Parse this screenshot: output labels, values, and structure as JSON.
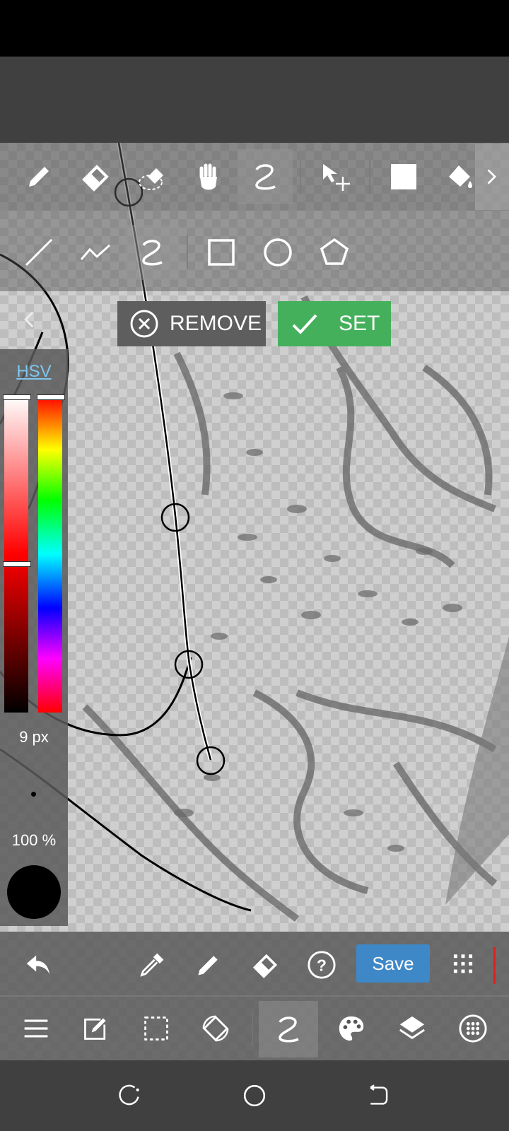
{
  "toolbar_top": {
    "tools": [
      {
        "name": "pencil-icon"
      },
      {
        "name": "eraser-icon"
      },
      {
        "name": "selection-eraser-icon"
      },
      {
        "name": "hand-icon"
      },
      {
        "name": "curve-icon",
        "active": true
      },
      {
        "name": "move-select-icon"
      },
      {
        "name": "fill-rect-icon"
      },
      {
        "name": "fill-bucket-icon"
      },
      {
        "name": "chevron-right-icon"
      }
    ]
  },
  "toolbar_shapes": {
    "tools": [
      {
        "name": "line-icon"
      },
      {
        "name": "polyline-icon"
      },
      {
        "name": "curve-icon",
        "active": true
      },
      {
        "name": "rectangle-icon"
      },
      {
        "name": "circle-icon"
      },
      {
        "name": "pentagon-icon"
      }
    ]
  },
  "actions": {
    "remove_label": "REMOVE",
    "set_label": "SET"
  },
  "color_panel": {
    "mode_label": "HSV",
    "brush_size": "9 px",
    "opacity": "100 %",
    "current_color": "#000000"
  },
  "bottom_toolbar": {
    "save_label": "Save"
  },
  "colors": {
    "set_green": "#45b05c",
    "save_blue": "#3e88c8",
    "hsv_link": "#7ec7ef"
  }
}
